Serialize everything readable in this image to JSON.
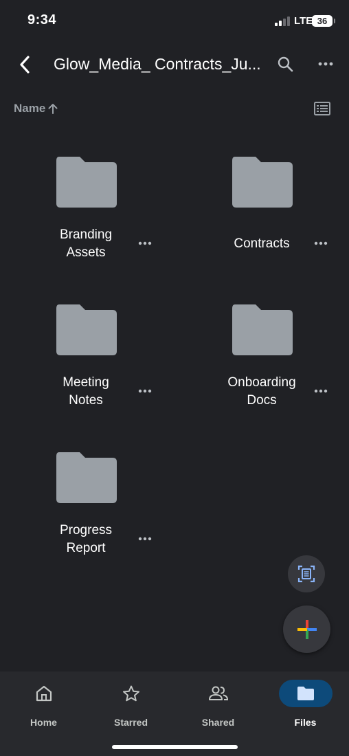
{
  "status_bar": {
    "time": "9:34",
    "network": "LTE",
    "battery": "36"
  },
  "header": {
    "title": "Glow_Media_ Contracts_Ju...",
    "back_icon": "chevron-left-icon",
    "search_icon": "search-icon",
    "more_icon": "more-horizontal-icon"
  },
  "sort": {
    "label": "Name",
    "direction_icon": "arrow-up-icon",
    "view_icon": "list-view-icon"
  },
  "folders": [
    {
      "name_line1": "Branding",
      "name_line2": "Assets"
    },
    {
      "name_line1": "Contracts",
      "name_line2": ""
    },
    {
      "name_line1": "Meeting",
      "name_line2": "Notes"
    },
    {
      "name_line1": "Onboarding",
      "name_line2": "Docs"
    },
    {
      "name_line1": "Progress",
      "name_line2": "Report"
    }
  ],
  "fabs": {
    "scan_icon": "document-scanner-icon",
    "new_icon": "plus-icon"
  },
  "bottom_nav": {
    "items": [
      {
        "label": "Home",
        "icon": "home-icon",
        "active": false
      },
      {
        "label": "Starred",
        "icon": "star-icon",
        "active": false
      },
      {
        "label": "Shared",
        "icon": "people-icon",
        "active": false
      },
      {
        "label": "Files",
        "icon": "folder-icon",
        "active": true
      }
    ]
  },
  "colors": {
    "background": "#202125",
    "folder": "#9aa0a6",
    "active_nav": "#0d4a7a",
    "accent_blue": "#8ab4f8"
  }
}
